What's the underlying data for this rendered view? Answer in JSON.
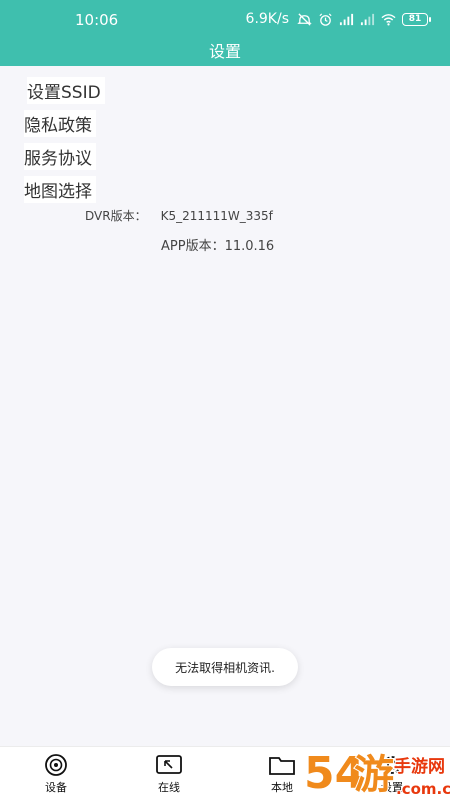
{
  "status_bar": {
    "time": "10:06",
    "net_speed": "6.9K/s",
    "battery": "81",
    "accent": "#3fbfae"
  },
  "header": {
    "title": "设置"
  },
  "menu": [
    {
      "label": "设置SSID"
    },
    {
      "label": "隐私政策"
    },
    {
      "label": "服务协议"
    },
    {
      "label": "地图选择"
    }
  ],
  "info": {
    "dvr_label": "DVR版本：",
    "dvr_value": "K5_211111W_335f",
    "app_label": "APP版本：",
    "app_value": "11.0.16"
  },
  "toast": {
    "message": "无法取得相机资讯."
  },
  "tabs": [
    {
      "label": "设备",
      "icon": "camera-lens-icon"
    },
    {
      "label": "在线",
      "icon": "arrow-box-icon"
    },
    {
      "label": "本地",
      "icon": "folder-icon"
    },
    {
      "label": "设置",
      "icon": "gear-icon"
    }
  ],
  "watermark": {
    "text": "54游手游网",
    "domain": ".com.cn"
  }
}
